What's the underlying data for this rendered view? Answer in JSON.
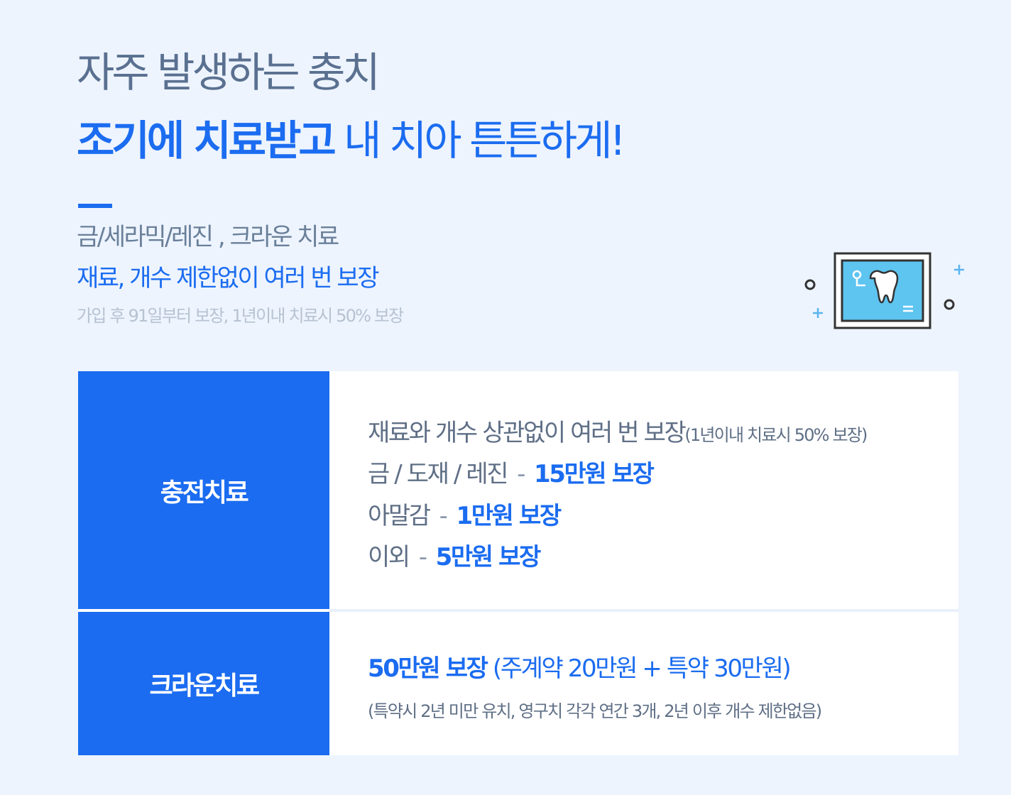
{
  "header": {
    "line1": "자주 발생하는 충치",
    "line2_bold": "조기에 치료받고",
    "line2_rest": " 내 치아 튼튼하게!"
  },
  "intro": {
    "treatments": "금/세라믹/레진 , 크라운 치료",
    "coverage": "재료, 개수 제한없이 여러 번 보장",
    "note": "가입 후 91일부터 보장, 1년이내 치료시 50% 보장"
  },
  "icon": "tooth-xray-monitor-icon",
  "colors": {
    "accent": "#1b6cf0",
    "background": "#edf4fe"
  },
  "table": {
    "filling": {
      "label": "충전치료",
      "intro_main": "재료와 개수 상관없이 여러 번 보장",
      "intro_small": "(1년이내 치료시 50% 보장)",
      "items": [
        {
          "name": "금 / 도재 / 레진",
          "dash": "-",
          "amount": "15만원 보장"
        },
        {
          "name": "아말감",
          "dash": "-",
          "amount": "1만원 보장"
        },
        {
          "name": "이외",
          "dash": "-",
          "amount": "5만원 보장"
        }
      ]
    },
    "crown": {
      "label": "크라운치료",
      "amount": "50만원 보장",
      "detail": " (주계약 20만원 + 특약 30만원)",
      "note": "(특약시 2년 미만 유치, 영구치 각각 연간 3개, 2년 이후 개수 제한없음)"
    }
  }
}
